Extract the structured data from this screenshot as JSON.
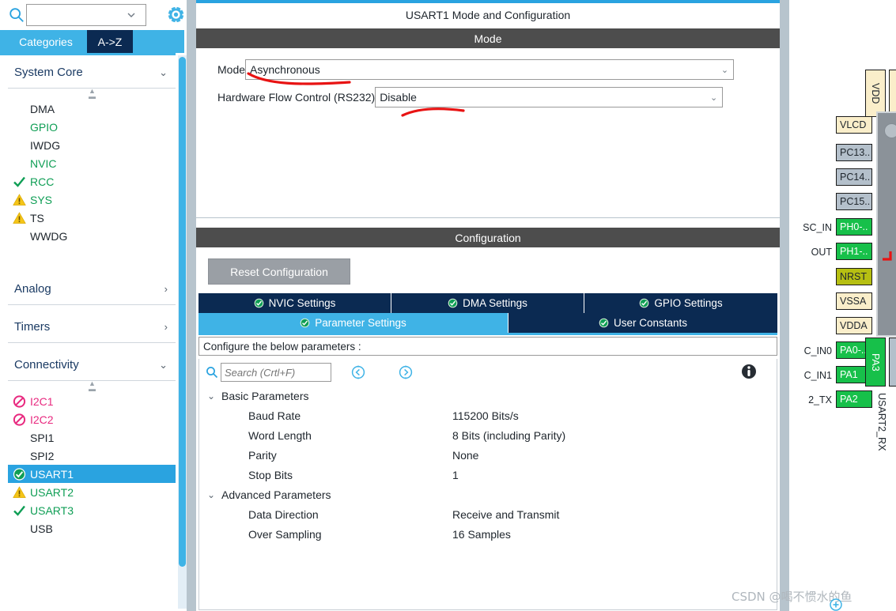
{
  "app": {
    "ip_title": "USART1 Mode and Configuration",
    "watermark": "CSDN @喝不惯水的鱼"
  },
  "left_panel": {
    "search": {
      "value": "",
      "placeholder": ""
    },
    "gear_icon": "gear-icon",
    "search_icon": "search-icon",
    "tabs": [
      {
        "label": "Categories",
        "active": true
      },
      {
        "label": "A->Z",
        "active": false
      }
    ],
    "groups": [
      {
        "title": "System Core",
        "expanded": true,
        "items": [
          {
            "label": "DMA",
            "state": "none",
            "color": "#20272e"
          },
          {
            "label": "GPIO",
            "state": "none",
            "color": "#0f9e55"
          },
          {
            "label": "IWDG",
            "state": "none",
            "color": "#20272e"
          },
          {
            "label": "NVIC",
            "state": "none",
            "color": "#0f9e55"
          },
          {
            "label": "RCC",
            "state": "check",
            "color": "#0f9e55"
          },
          {
            "label": "SYS",
            "state": "warning",
            "color": "#0f9e55"
          },
          {
            "label": "TS",
            "state": "warning",
            "color": "#20272e"
          },
          {
            "label": "WWDG",
            "state": "none",
            "color": "#20272e"
          }
        ]
      },
      {
        "title": "Analog",
        "expanded": false,
        "items": []
      },
      {
        "title": "Timers",
        "expanded": false,
        "items": []
      },
      {
        "title": "Connectivity",
        "expanded": true,
        "items": [
          {
            "label": "I2C1",
            "state": "forbidden",
            "color": "#e8297f"
          },
          {
            "label": "I2C2",
            "state": "forbidden",
            "color": "#e8297f"
          },
          {
            "label": "SPI1",
            "state": "none",
            "color": "#20272e"
          },
          {
            "label": "SPI2",
            "state": "none",
            "color": "#20272e"
          },
          {
            "label": "USART1",
            "state": "check-sel",
            "color": "#ffffff",
            "selected": true
          },
          {
            "label": "USART2",
            "state": "warning",
            "color": "#0f9e55"
          },
          {
            "label": "USART3",
            "state": "check",
            "color": "#0f9e55"
          },
          {
            "label": "USB",
            "state": "none",
            "color": "#20272e"
          }
        ]
      }
    ]
  },
  "mode_section": {
    "band_title": "Mode",
    "rows": [
      {
        "label": "Mode",
        "value": "Asynchronous"
      },
      {
        "label": "Hardware Flow Control (RS232)",
        "value": "Disable"
      }
    ]
  },
  "configuration": {
    "band_title": "Configuration",
    "reset_button": "Reset Configuration",
    "tabs_top": [
      {
        "label": "NVIC Settings",
        "active": false
      },
      {
        "label": "DMA Settings",
        "active": false
      },
      {
        "label": "GPIO Settings",
        "active": false
      }
    ],
    "tabs_bottom": [
      {
        "label": "Parameter Settings",
        "active": true
      },
      {
        "label": "User Constants",
        "active": false
      }
    ],
    "hint": "Configure the below parameters :",
    "search": {
      "value": "",
      "placeholder": "Search (Crtl+F)"
    },
    "nav_prev_icon": "chevron-left-circle-icon",
    "nav_next_icon": "chevron-right-circle-icon",
    "info_icon": "info-icon",
    "tree": [
      {
        "group": "Basic Parameters",
        "expanded": true,
        "rows": [
          {
            "name": "Baud Rate",
            "value": "115200 Bits/s"
          },
          {
            "name": "Word Length",
            "value": "8 Bits (including Parity)"
          },
          {
            "name": "Parity",
            "value": "None"
          },
          {
            "name": "Stop Bits",
            "value": "1"
          }
        ]
      },
      {
        "group": "Advanced Parameters",
        "expanded": true,
        "rows": [
          {
            "name": "Data Direction",
            "value": "Receive and Transmit"
          },
          {
            "name": "Over Sampling",
            "value": "16 Samples"
          }
        ]
      }
    ]
  },
  "pin_view": {
    "vertical_top_pins": [
      {
        "label": "VDD",
        "kind": "power"
      }
    ],
    "left_pins": [
      {
        "label": "VLCD",
        "kind": "power",
        "side_label": ""
      },
      {
        "label": "PC13..",
        "kind": "gray",
        "side_label": ""
      },
      {
        "label": "PC14..",
        "kind": "gray",
        "side_label": ""
      },
      {
        "label": "PC15..",
        "kind": "gray",
        "side_label": ""
      },
      {
        "label": "PH0-..",
        "kind": "green",
        "side_label": "SC_IN"
      },
      {
        "label": "PH1-..",
        "kind": "green",
        "side_label": "OUT"
      },
      {
        "label": "NRST",
        "kind": "reset",
        "side_label": ""
      },
      {
        "label": "VSSA",
        "kind": "power",
        "side_label": ""
      },
      {
        "label": "VDDA",
        "kind": "power",
        "side_label": ""
      },
      {
        "label": "PA0-..",
        "kind": "green",
        "side_label": "C_IN0"
      },
      {
        "label": "PA1",
        "kind": "green",
        "side_label": "C_IN1"
      },
      {
        "label": "PA2",
        "kind": "green",
        "side_label": "2_TX"
      }
    ],
    "bottom_pins": [
      {
        "label": "PA3",
        "kind": "green",
        "signal": "USART2_RX"
      }
    ]
  },
  "colors": {
    "accent_blue": "#3fb3e6",
    "dark_navy": "#0b2a52",
    "band_gray": "#4d4d4d",
    "green_ok": "#0f9e55",
    "pink_block": "#e8297f",
    "warn_yellow": "#f5c518",
    "pin_green": "#17c04a",
    "pin_power": "#faeeca",
    "annotation_red": "#e81313"
  }
}
